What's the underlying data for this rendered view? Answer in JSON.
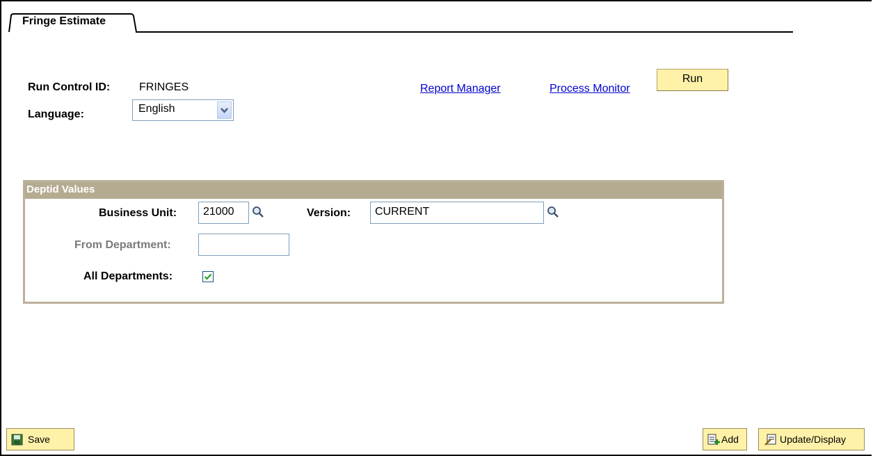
{
  "tab": {
    "label": "Fringe Estimate"
  },
  "run_control": {
    "label": "Run Control ID:",
    "value": "FRINGES"
  },
  "language": {
    "label": "Language:",
    "selected": "English"
  },
  "links": {
    "report_manager": "Report Manager",
    "process_monitor": "Process Monitor"
  },
  "run_button": {
    "label": "Run"
  },
  "deptid_group": {
    "title": "Deptid Values",
    "business_unit": {
      "label": "Business Unit:",
      "value": "21000"
    },
    "version": {
      "label": "Version:",
      "value": "CURRENT"
    },
    "from_department": {
      "label": "From Department:",
      "value": ""
    },
    "all_departments": {
      "label": "All Departments:",
      "checked": true
    }
  },
  "footer": {
    "save": "Save",
    "add": "Add",
    "update_display": "Update/Display"
  },
  "colors": {
    "button_bg": "#fff2a8",
    "group_header": "#b5ab91",
    "link": "#0000cc"
  }
}
